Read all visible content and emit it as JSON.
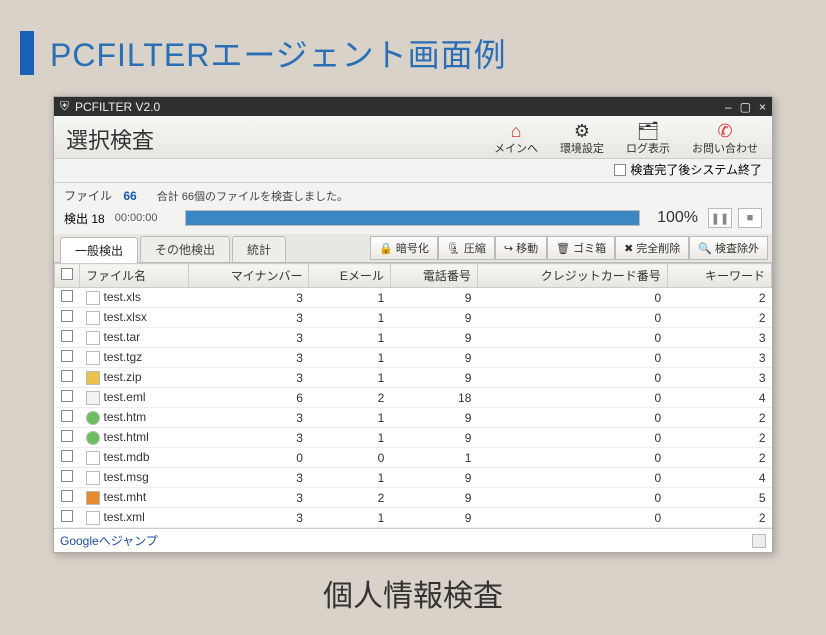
{
  "slide": {
    "title": "PCFILTERエージェント画面例",
    "bottom_title": "個人情報検査"
  },
  "window": {
    "title": "PCFILTER V2.0",
    "controls": {
      "min": "–",
      "max": "▢",
      "close": "×"
    }
  },
  "toolbar": {
    "heading": "選択検査",
    "buttons": [
      {
        "id": "main",
        "label": "メインへ",
        "icon": "⌂",
        "color": "icon-red"
      },
      {
        "id": "env",
        "label": "環境設定",
        "icon": "⚙"
      },
      {
        "id": "log",
        "label": "ログ表示",
        "icon": "🗂"
      },
      {
        "id": "inq",
        "label": "お問い合わせ",
        "icon": "✆",
        "color": "icon-red"
      }
    ]
  },
  "option": {
    "label": "検査完了後システム終了"
  },
  "stats": {
    "file_label": "ファイル",
    "file_count": "66",
    "detect_label": "検出",
    "detect_count": "18",
    "summary": "合計 66個のファイルを検査しました。",
    "elapsed": "00:00:00",
    "percent": "100%",
    "bar_pct": 100
  },
  "tabs": [
    {
      "id": "general",
      "label": "一般検出",
      "active": true
    },
    {
      "id": "other",
      "label": "その他検出"
    },
    {
      "id": "stat",
      "label": "統計"
    }
  ],
  "actions": [
    {
      "id": "encrypt",
      "icon": "🔒",
      "label": "暗号化"
    },
    {
      "id": "compress",
      "icon": "🗜",
      "label": "圧縮"
    },
    {
      "id": "move",
      "icon": "↪",
      "label": "移動"
    },
    {
      "id": "trash",
      "icon": "🗑",
      "label": "ゴミ箱"
    },
    {
      "id": "delete",
      "icon": "✖",
      "label": "完全削除"
    },
    {
      "id": "exclude",
      "icon": "🔍",
      "label": "検査除外"
    }
  ],
  "columns": {
    "filename": "ファイル名",
    "mynumber": "マイナンバー",
    "email": "Eメール",
    "phone": "電話番号",
    "cc": "クレジットカード番号",
    "keyword": "キーワード"
  },
  "rows": [
    {
      "file": "test.xls",
      "icon": "def",
      "c": [
        3,
        1,
        9,
        0,
        2
      ]
    },
    {
      "file": "test.xlsx",
      "icon": "def",
      "c": [
        3,
        1,
        9,
        0,
        2
      ]
    },
    {
      "file": "test.tar",
      "icon": "def",
      "c": [
        3,
        1,
        9,
        0,
        3
      ]
    },
    {
      "file": "test.tgz",
      "icon": "def",
      "c": [
        3,
        1,
        9,
        0,
        3
      ]
    },
    {
      "file": "test.zip",
      "icon": "zip",
      "c": [
        3,
        1,
        9,
        0,
        3
      ]
    },
    {
      "file": "test.eml",
      "icon": "eml",
      "c": [
        6,
        2,
        18,
        0,
        4
      ]
    },
    {
      "file": "test.htm",
      "icon": "htm",
      "c": [
        3,
        1,
        9,
        0,
        2
      ]
    },
    {
      "file": "test.html",
      "icon": "htm",
      "c": [
        3,
        1,
        9,
        0,
        2
      ]
    },
    {
      "file": "test.mdb",
      "icon": "def",
      "c": [
        0,
        0,
        1,
        0,
        2
      ]
    },
    {
      "file": "test.msg",
      "icon": "def",
      "c": [
        3,
        1,
        9,
        0,
        4
      ]
    },
    {
      "file": "test.mht",
      "icon": "mht",
      "c": [
        3,
        2,
        9,
        0,
        5
      ]
    },
    {
      "file": "test.xml",
      "icon": "def",
      "c": [
        3,
        1,
        9,
        0,
        2
      ]
    }
  ],
  "footer": {
    "google_link": "Googleへジャンプ"
  }
}
